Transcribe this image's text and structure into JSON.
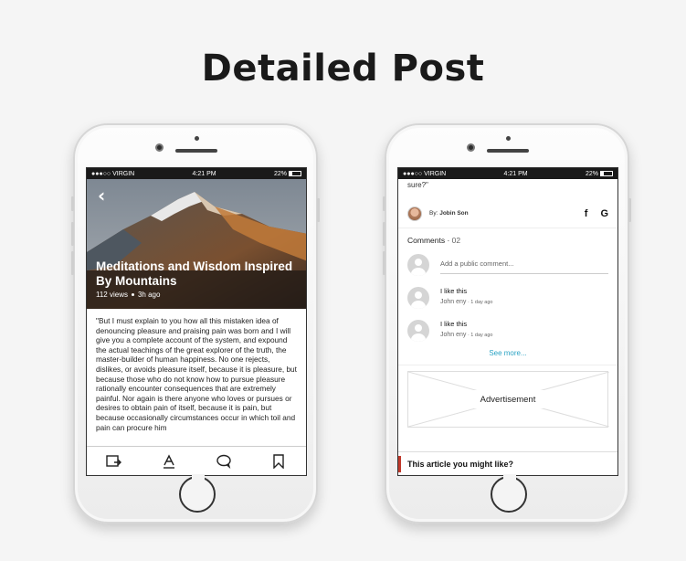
{
  "page": {
    "title": "Detailed Post"
  },
  "status_bar": {
    "carrier": "●●●○○ VIRGIN",
    "time": "4:21 PM",
    "battery": "22%"
  },
  "post": {
    "title": "Meditations and Wisdom Inspired By Mountains",
    "views": "112 views",
    "age": "3h ago",
    "body": "\"But I must explain to you how all this mistaken idea of denouncing pleasure and praising pain was born and I will give you a complete account of the system, and expound the actual teachings of the great explorer of the truth, the master-builder of human happiness. No one rejects, dislikes, or avoids pleasure itself, because it is pleasure, but because those who do not know how to pursue pleasure rationally encounter consequences that are extremely painful. Nor again is there anyone who loves or pursues or desires to obtain pain of itself, because it is pain, but because occasionally circumstances occur in which toil and pain can procure him"
  },
  "toolbar_icons": [
    "share-icon",
    "font-size-icon",
    "comment-icon",
    "bookmark-icon"
  ],
  "detail": {
    "quote_tail": "sure?\"",
    "author_by": "By: ",
    "author_name": "Jobin Son",
    "facebook": "f",
    "google": "G",
    "comments_label": "Comments · ",
    "comments_count": "02",
    "add_comment_placeholder": "Add a public comment...",
    "comments": [
      {
        "text": "I like this",
        "author": "John eny",
        "time": " · 1 day ago"
      },
      {
        "text": "I like this",
        "author": "John eny",
        "time": " · 1 day ago"
      }
    ],
    "see_more": "See more...",
    "ad_label": "Advertisement",
    "might_like": "This article you might like?"
  },
  "colors": {
    "accent_link": "#2aa3c4",
    "section_marker": "#c0392b"
  }
}
